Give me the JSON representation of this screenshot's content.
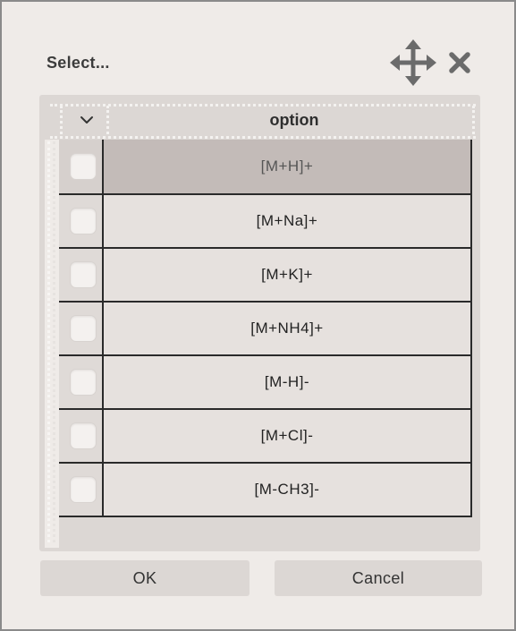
{
  "dialog": {
    "title": "Select...",
    "icons": {
      "move": "move-arrows-icon",
      "close": "close-x-icon",
      "expand": "chevron-down-icon"
    }
  },
  "table": {
    "column_header": "option",
    "rows": [
      {
        "label": "[M+H]+",
        "selected": true,
        "checked": false
      },
      {
        "label": "[M+Na]+",
        "selected": false,
        "checked": false
      },
      {
        "label": "[M+K]+",
        "selected": false,
        "checked": false
      },
      {
        "label": "[M+NH4]+",
        "selected": false,
        "checked": false
      },
      {
        "label": "[M-H]-",
        "selected": false,
        "checked": false
      },
      {
        "label": "[M+Cl]-",
        "selected": false,
        "checked": false
      },
      {
        "label": "[M-CH3]-",
        "selected": false,
        "checked": false
      }
    ]
  },
  "buttons": {
    "ok": "OK",
    "cancel": "Cancel"
  },
  "colors": {
    "dialog_bg": "#efebe8",
    "panel_bg": "#dcd7d4",
    "selected_row_bg": "#c3bbb8",
    "row_bg": "#e6e1de",
    "icon_color": "#6b6b6b"
  }
}
